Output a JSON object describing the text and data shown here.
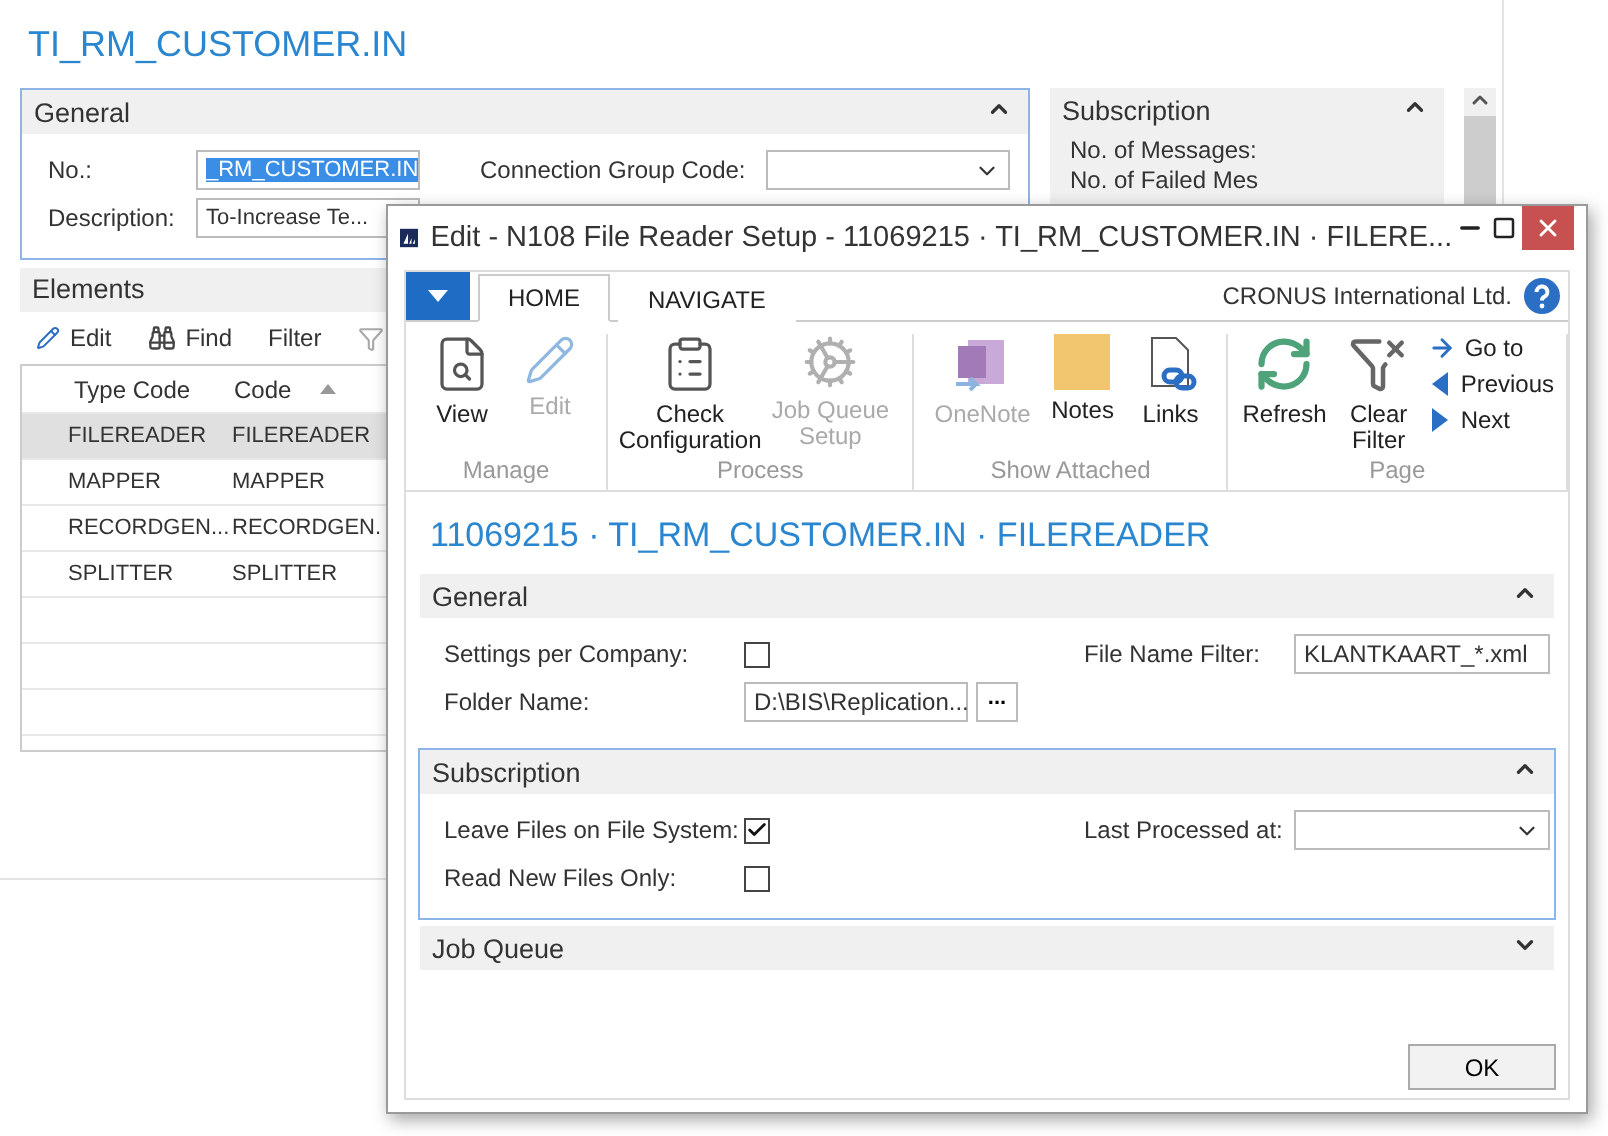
{
  "page": {
    "title": "TI_RM_CUSTOMER.IN",
    "general": {
      "title": "General",
      "expanded": true,
      "focused": true,
      "left": [
        {
          "kind": "text",
          "label": "No.:",
          "value": "_RM_CUSTOMER.IN",
          "selected": true
        },
        {
          "kind": "text",
          "label": "Description:",
          "value": "To-Increase Te...",
          "selected": false
        }
      ],
      "right": [
        {
          "kind": "dropdown",
          "label": "Connection Group Code:"
        }
      ]
    },
    "subscription": {
      "title": "Subscription",
      "expanded": true,
      "lines": [
        "No. of Messages:",
        "No. of Failed Mes"
      ]
    },
    "elements": {
      "title": "Elements",
      "actions": [
        "Edit",
        "Find",
        "Filter"
      ],
      "columns": [
        "Type Code",
        "Code"
      ],
      "rows": [
        {
          "cells": [
            "FILEREADER",
            "FILEREADER"
          ],
          "selected": true
        },
        {
          "cells": [
            "MAPPER",
            "MAPPER"
          ],
          "selected": false
        },
        {
          "cells": [
            "RECORDGEN...",
            "RECORDGEN."
          ],
          "selected": false
        },
        {
          "cells": [
            "SPLITTER",
            "SPLITTER"
          ],
          "selected": false
        }
      ]
    }
  },
  "dialog": {
    "title": "Edit - N108 File Reader Setup - 11069215 · TI_RM_CUSTOMER.IN · FILERE...",
    "tabs": [
      {
        "label": "HOME",
        "selected": true
      },
      {
        "label": "NAVIGATE",
        "selected": false
      }
    ],
    "company": "CRONUS International Ltd.",
    "ribbon": [
      {
        "label": "Manage",
        "buttons": [
          {
            "kind": "large",
            "label": "View",
            "disabled": false
          },
          {
            "kind": "large",
            "label": "Edit",
            "disabled": true
          }
        ]
      },
      {
        "label": "Process",
        "buttons": [
          {
            "kind": "large",
            "label": "Check Configuration",
            "disabled": false
          },
          {
            "kind": "large",
            "label": "Job Queue Setup",
            "disabled": true
          }
        ]
      },
      {
        "label": "Show Attached",
        "buttons": [
          {
            "kind": "large",
            "label": "OneNote",
            "disabled": true
          },
          {
            "kind": "large",
            "label": "Notes",
            "disabled": false
          },
          {
            "kind": "large",
            "label": "Links",
            "disabled": false
          }
        ]
      },
      {
        "label": "Page",
        "buttons": [
          {
            "kind": "large",
            "label": "Refresh",
            "disabled": false
          },
          {
            "kind": "large",
            "label": "Clear Filter",
            "disabled": false
          },
          {
            "kind": "small",
            "label": "Go to",
            "disabled": false
          },
          {
            "kind": "small",
            "label": "Previous",
            "disabled": false
          },
          {
            "kind": "small",
            "label": "Next",
            "disabled": false
          }
        ]
      }
    ],
    "heading": "11069215 · TI_RM_CUSTOMER.IN · FILEREADER",
    "sections": [
      {
        "title": "General",
        "expanded": true,
        "focused": false,
        "left": [
          {
            "kind": "checkbox",
            "label": "Settings per Company:",
            "checked": false
          },
          {
            "kind": "file",
            "label": "Folder Name:",
            "value": "D:\\BIS\\Replication...",
            "button": "..."
          }
        ],
        "right": [
          {
            "kind": "text",
            "label": "File Name Filter:",
            "value": "KLANTKAART_*.xml",
            "selected": false
          }
        ]
      },
      {
        "title": "Subscription",
        "expanded": true,
        "focused": true,
        "left": [
          {
            "kind": "checkbox",
            "label": "Leave Files on File System:",
            "checked": true
          },
          {
            "kind": "checkbox",
            "label": "Read New Files Only:",
            "checked": false
          }
        ],
        "right": [
          {
            "kind": "dropdown",
            "label": "Last Processed at:"
          }
        ]
      },
      {
        "title": "Job Queue",
        "expanded": false,
        "focused": false
      }
    ],
    "ok": "OK"
  }
}
